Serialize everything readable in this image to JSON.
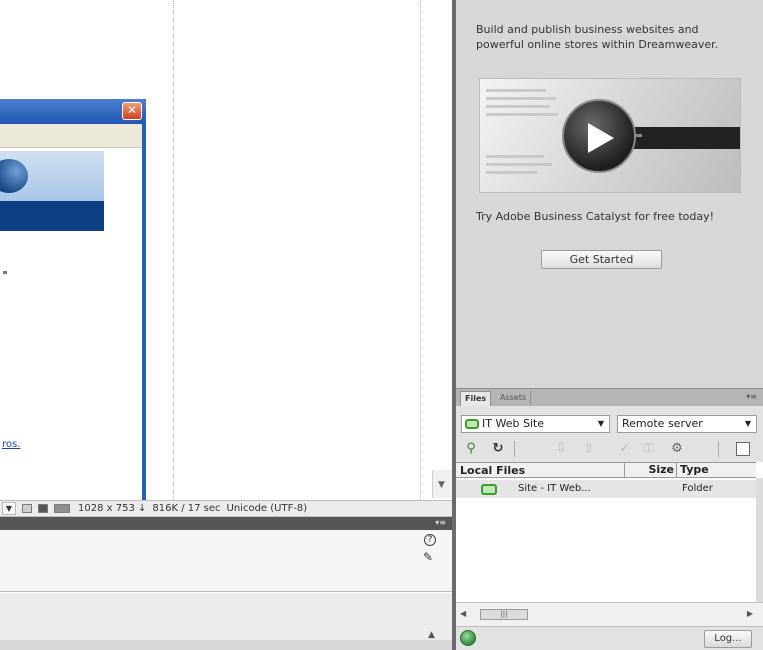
{
  "promo": {
    "description": "Build and publish business websites and powerful online stores within Dreamweaver.",
    "offer": "Try Adobe Business Catalyst for free today!",
    "get_started_label": "Get Started"
  },
  "status_bar": {
    "dimensions": "1028 x 753 ↓",
    "size_time": "816K / 17 sec",
    "encoding": "Unicode (UTF-8)"
  },
  "files_panel": {
    "tabs": [
      {
        "label": "Files",
        "active": true
      },
      {
        "label": "Assets",
        "active": false
      }
    ],
    "site_select": "IT Web Site",
    "view_select": "Remote server",
    "columns": {
      "local": "Local Files",
      "size": "Size",
      "type": "Type"
    },
    "rows": [
      {
        "name": "Site - IT Web...",
        "type": "Folder"
      }
    ],
    "log_label": "Log..."
  },
  "document": {
    "link_fragment": "ros."
  },
  "icons": {
    "close": "close-icon",
    "play": "play-icon",
    "help": "help-icon",
    "edit": "edit-icon",
    "connect": "connect-icon",
    "refresh": "refresh-icon",
    "get": "get-files-icon",
    "put": "put-files-icon",
    "checkout": "check-out-icon",
    "checkin": "check-in-icon",
    "sync": "synchronize-icon",
    "expand": "expand-icon",
    "globe": "globe-icon",
    "folder": "folder-icon"
  },
  "colors": {
    "dialog_titlebar": "#2156b3",
    "dialog_close": "#d2421c",
    "site_green": "#3a9a2c",
    "panel_gray": "#d7d7d7"
  }
}
